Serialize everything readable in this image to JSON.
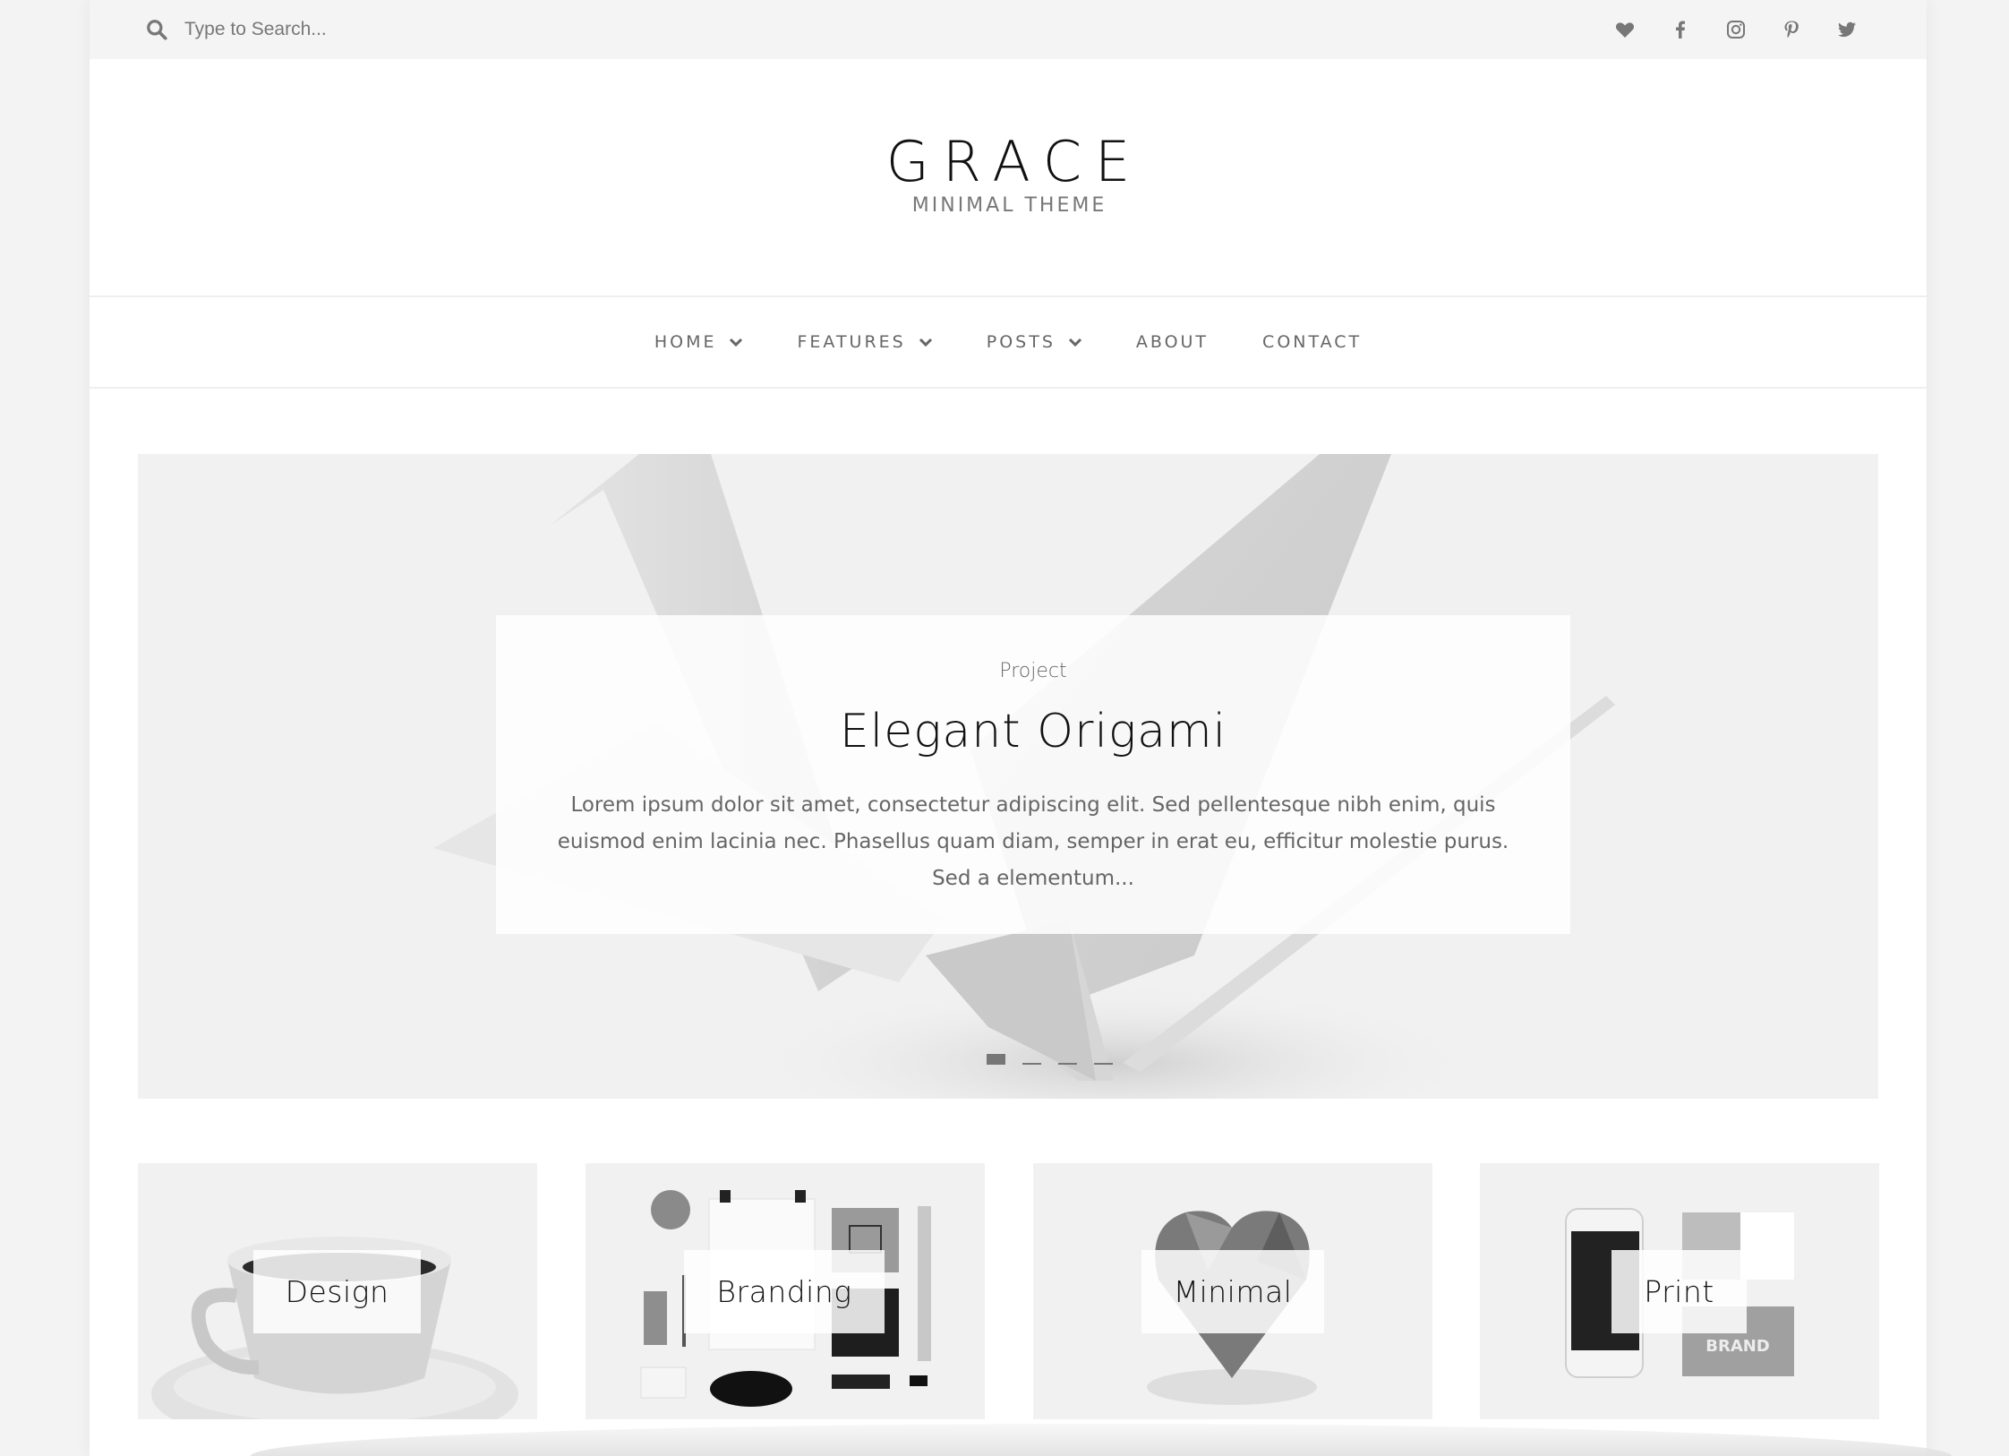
{
  "topbar": {
    "search_placeholder": "Type to Search...",
    "social_icons": [
      "heart-icon",
      "facebook-icon",
      "instagram-icon",
      "pinterest-icon",
      "twitter-icon"
    ]
  },
  "logo": {
    "title": "GRACE",
    "subtitle": "MINIMAL THEME"
  },
  "nav": {
    "items": [
      {
        "label": "HOME",
        "has_dropdown": true
      },
      {
        "label": "FEATURES",
        "has_dropdown": true
      },
      {
        "label": "POSTS",
        "has_dropdown": true
      },
      {
        "label": "ABOUT",
        "has_dropdown": false
      },
      {
        "label": "CONTACT",
        "has_dropdown": false
      }
    ]
  },
  "hero": {
    "category": "Project",
    "title": "Elegant Origami",
    "excerpt": "Lorem ipsum dolor sit amet, consectetur adipiscing elit. Sed pellentesque nibh enim, quis euismod enim lacinia nec. Phasellus quam diam, semper in erat eu, efficitur molestie purus. Sed a elementum...",
    "slides_total": 4,
    "active_slide": 1
  },
  "tiles": [
    {
      "label": "Design"
    },
    {
      "label": "Branding"
    },
    {
      "label": "Minimal"
    },
    {
      "label": "Print"
    }
  ],
  "colors": {
    "topbar_bg": "#f4f4f4",
    "text_dark": "#111111",
    "text_muted": "#666666",
    "icon": "#777777"
  }
}
